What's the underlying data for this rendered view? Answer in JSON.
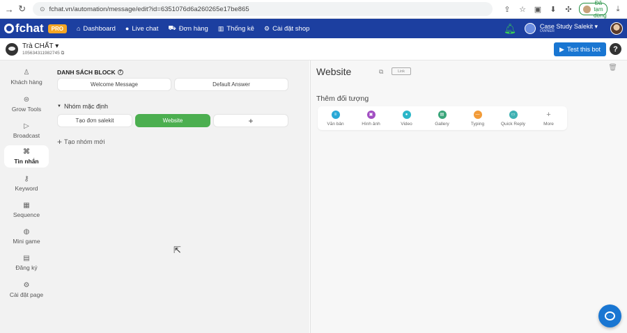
{
  "browser": {
    "url": "fchat.vn/automation/message/edit?id=6351076d6a260265e17be865",
    "paused_label": "Đã tạm dừng"
  },
  "nav": {
    "logo": "fchat",
    "pro_badge": "PRO",
    "items": [
      {
        "label": "Dashboard",
        "icon": "home-icon"
      },
      {
        "label": "Live chat",
        "icon": "chat-icon"
      },
      {
        "label": "Đơn hàng",
        "icon": "cart-icon"
      },
      {
        "label": "Thống kê",
        "icon": "chart-icon"
      },
      {
        "label": "Cài đặt shop",
        "icon": "settings-icon"
      }
    ],
    "account_name": "Case Study Salekit",
    "account_sub": "OWNER"
  },
  "page": {
    "name": "Trà CHẤT",
    "id": "105634311982745",
    "test_bot_label": "Test this bot",
    "help_label": "?"
  },
  "sidebar": {
    "items": [
      {
        "label": "Khách hàng",
        "icon": "user-icon",
        "active": false
      },
      {
        "label": "Grow Tools",
        "icon": "grow-icon",
        "active": false
      },
      {
        "label": "Broadcast",
        "icon": "play-icon",
        "active": false
      },
      {
        "label": "Tin nhắn",
        "icon": "message-icon",
        "active": true
      },
      {
        "label": "Keyword",
        "icon": "key-icon",
        "active": false
      },
      {
        "label": "Sequence",
        "icon": "calendar-icon",
        "active": false
      },
      {
        "label": "Mini game",
        "icon": "gamepad-icon",
        "active": false
      },
      {
        "label": "Đăng ký",
        "icon": "form-icon",
        "active": false
      },
      {
        "label": "Cài đặt page",
        "icon": "gear-icon",
        "active": false
      }
    ]
  },
  "blocks": {
    "title": "DANH SÁCH BLOCK",
    "help": "?",
    "default_blocks": [
      "Welcome Message",
      "Default Answer"
    ],
    "group_title": "Nhóm mặc định",
    "group_blocks": [
      "Tạo đơn salekit",
      "Website"
    ],
    "add_block": "+",
    "new_group": "Tạo nhóm mới"
  },
  "editor": {
    "title": "Website",
    "link_label": "Link",
    "add_object_label": "Thêm đối tượng",
    "objects": [
      {
        "label": "Văn bản",
        "color": "#29a8d6"
      },
      {
        "label": "Hình ảnh",
        "color": "#a24fc2"
      },
      {
        "label": "Video",
        "color": "#2bb6c8"
      },
      {
        "label": "Gallery",
        "color": "#3aa57a"
      },
      {
        "label": "Typing",
        "color": "#f29b38"
      },
      {
        "label": "Quick Reply",
        "color": "#3fb1b3"
      }
    ],
    "more_label": "More"
  }
}
